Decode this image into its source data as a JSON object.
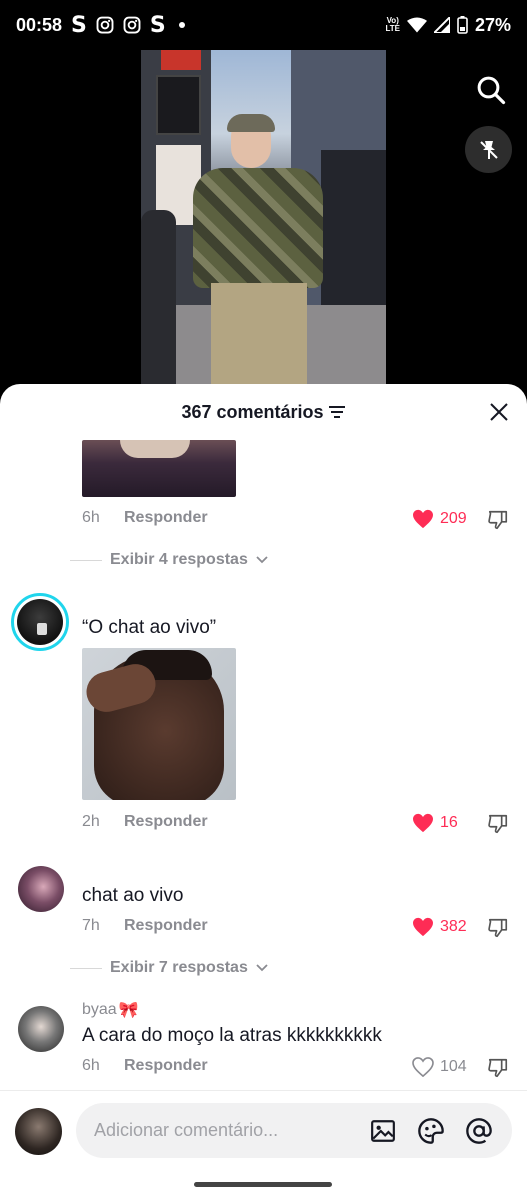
{
  "status_bar": {
    "time": "00:58",
    "app_icons": [
      "s-icon",
      "instagram-icon",
      "instagram-icon",
      "s-icon",
      "dot"
    ],
    "network": "VoLTE",
    "battery": "27%"
  },
  "comments_sheet": {
    "title": "367 comentários",
    "input_placeholder": "Adicionar comentário..."
  },
  "comments": [
    {
      "time": "6h",
      "reply_label": "Responder",
      "likes": "209",
      "liked": true,
      "view_replies": "Exibir 4 respostas"
    },
    {
      "text": "“O chat ao vivo”",
      "time": "2h",
      "reply_label": "Responder",
      "likes": "16",
      "liked": true
    },
    {
      "text": "chat ao vivo",
      "time": "7h",
      "reply_label": "Responder",
      "likes": "382",
      "liked": true,
      "view_replies": "Exibir 7 respostas"
    },
    {
      "username": "byaa",
      "username_emoji": "🎀",
      "text": "A cara do moço la atras kkkkkkkkkk",
      "time": "6h",
      "reply_label": "Responder",
      "likes": "104",
      "liked": false
    }
  ],
  "colors": {
    "like_red": "#fe2c55",
    "muted": "#8a8b91",
    "text": "#161823",
    "story_ring": "#20d5ec"
  }
}
